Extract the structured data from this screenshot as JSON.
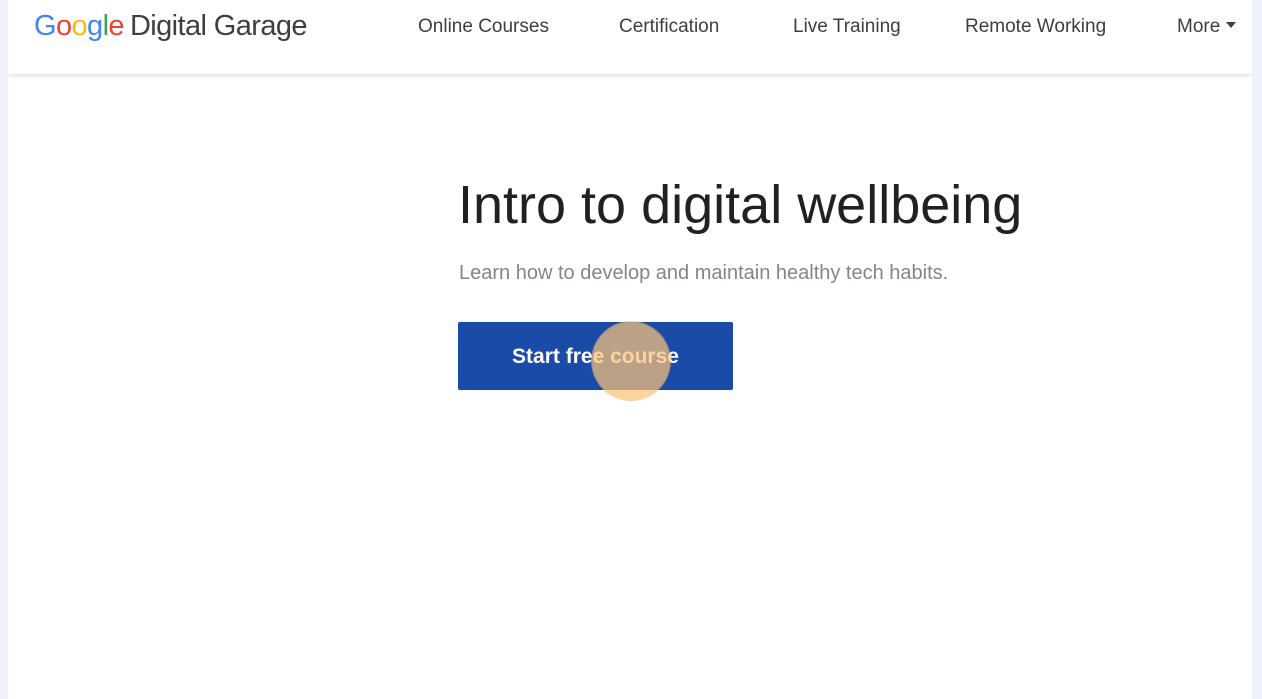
{
  "brand": {
    "google_letters": [
      "G",
      "o",
      "o",
      "g",
      "l",
      "e"
    ],
    "google_colors": [
      "#4285F4",
      "#EA4335",
      "#FBBC05",
      "#4285F4",
      "#34A853",
      "#EA4335"
    ],
    "product": "Digital Garage"
  },
  "nav": {
    "online_courses": "Online Courses",
    "certification": "Certification",
    "live_training": "Live Training",
    "remote_working": "Remote Working",
    "more": "More"
  },
  "hero": {
    "title": "Intro to digital wellbeing",
    "subtitle": "Learn how to develop and maintain healthy tech habits.",
    "cta_label": "Start free course"
  },
  "colors": {
    "cta_background": "#1a4ba8",
    "click_marker": "#fac478"
  }
}
